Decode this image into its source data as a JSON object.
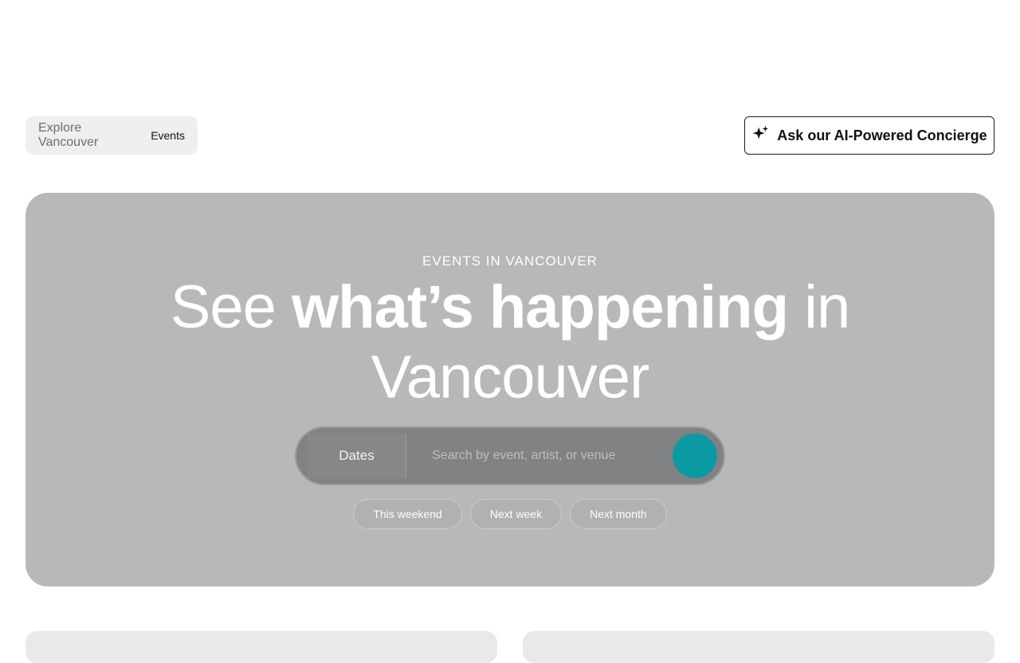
{
  "breadcrumb": {
    "parent": "Explore Vancouver",
    "current": "Events"
  },
  "concierge": {
    "label": "Ask our AI-Powered Concierge",
    "icon": "sparkle-icon"
  },
  "hero": {
    "eyebrow": "EVENTS IN VANCOUVER",
    "headline_part1": "See ",
    "headline_bold": "what’s happening",
    "headline_part2": " in Vancouver",
    "search": {
      "dates_label": "Dates",
      "placeholder": "Search by event, artist, or venue",
      "accent_color": "#0b9aa3"
    },
    "chips": [
      "This weekend",
      "Next week",
      "Next month"
    ]
  }
}
